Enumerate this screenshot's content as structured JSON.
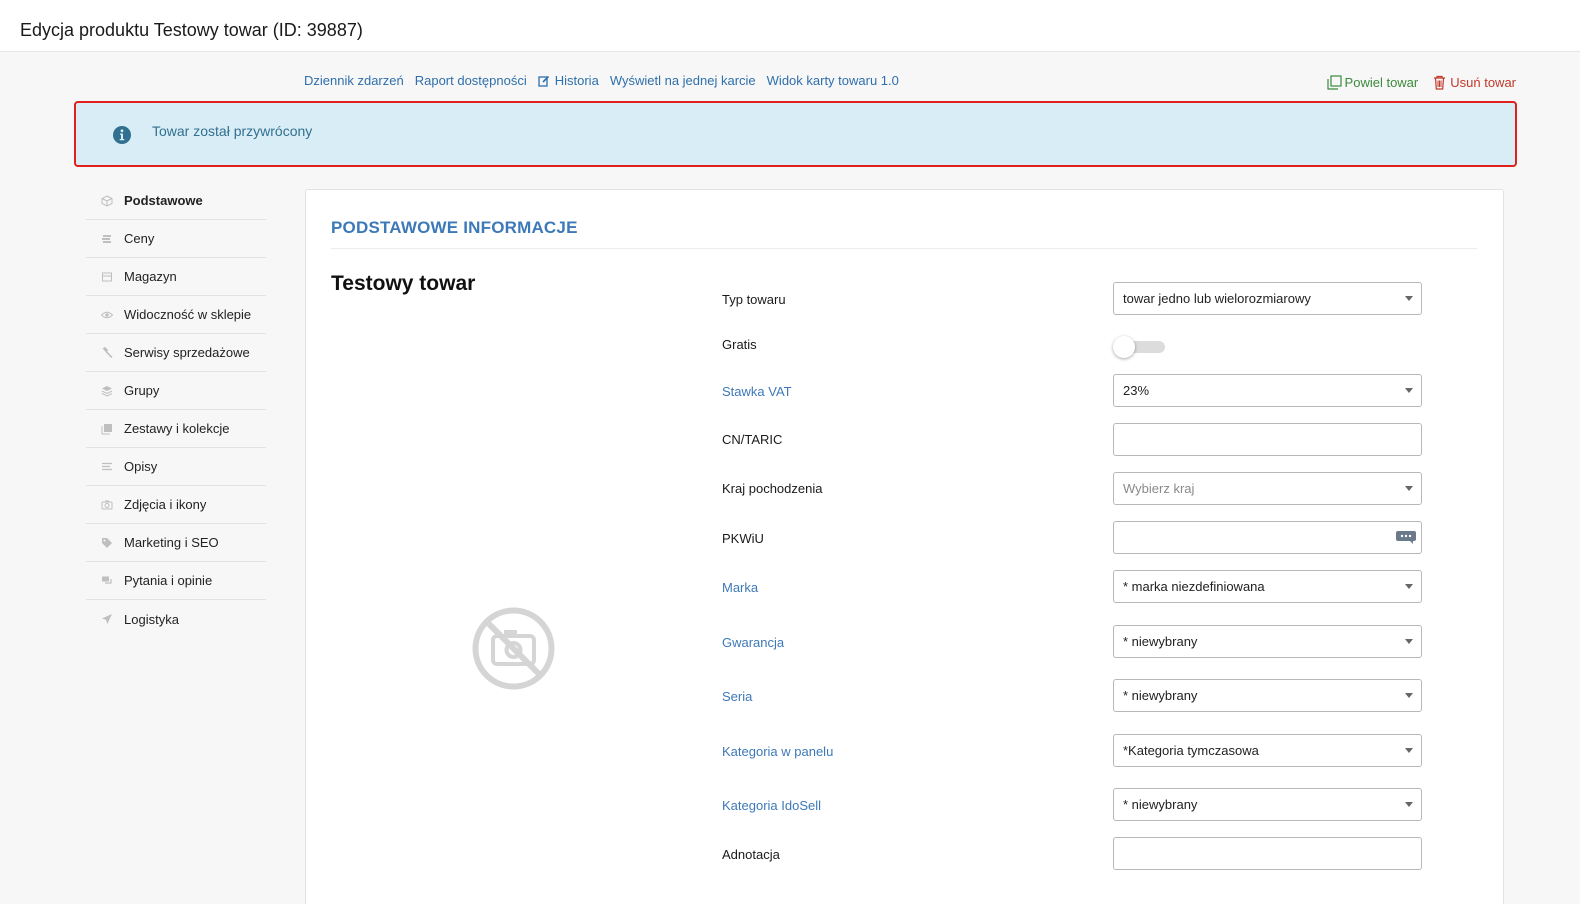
{
  "page": {
    "title": "Edycja produktu Testowy towar (ID: 39887)"
  },
  "topnav": [
    {
      "label": "Dziennik zdarzeń"
    },
    {
      "label": "Raport dostępności"
    },
    {
      "label": "Historia",
      "icon": "edit-icon"
    },
    {
      "label": "Wyświetl na jednej karcie"
    },
    {
      "label": "Widok karty towaru 1.0"
    }
  ],
  "actions": {
    "copy_label": "Powiel towar",
    "delete_label": "Usuń towar"
  },
  "alert": {
    "text": "Towar został przywrócony",
    "icon": "info-icon"
  },
  "sidebar": {
    "items": [
      {
        "label": "Podstawowe",
        "icon": "box-icon",
        "active": true
      },
      {
        "label": "Ceny",
        "icon": "coins-icon"
      },
      {
        "label": "Magazyn",
        "icon": "warehouse-icon"
      },
      {
        "label": "Widoczność w sklepie",
        "icon": "eye-icon"
      },
      {
        "label": "Serwisy sprzedażowe",
        "icon": "gavel-icon"
      },
      {
        "label": "Grupy",
        "icon": "layers-icon"
      },
      {
        "label": "Zestawy i kolekcje",
        "icon": "stack-icon"
      },
      {
        "label": "Opisy",
        "icon": "text-lines-icon"
      },
      {
        "label": "Zdjęcia i ikony",
        "icon": "camera-icon"
      },
      {
        "label": "Marketing i SEO",
        "icon": "tag-icon"
      },
      {
        "label": "Pytania i opinie",
        "icon": "comments-icon"
      },
      {
        "label": "Logistyka",
        "icon": "paper-plane-icon"
      }
    ]
  },
  "main": {
    "section_title": "PODSTAWOWE INFORMACJE",
    "product_name": "Testowy towar",
    "fields": {
      "typ_towaru": {
        "label": "Typ towaru",
        "value": "towar jedno lub wielorozmiarowy"
      },
      "gratis": {
        "label": "Gratis",
        "on": false
      },
      "stawka_vat": {
        "label": "Stawka VAT",
        "value": "23%"
      },
      "cn_taric": {
        "label": "CN/TARIC",
        "value": ""
      },
      "kraj_pochodzenia": {
        "label": "Kraj pochodzenia",
        "placeholder": "Wybierz kraj"
      },
      "pkwiu": {
        "label": "PKWiU",
        "value": ""
      },
      "marka": {
        "label": "Marka",
        "value": "* marka niezdefiniowana"
      },
      "gwarancja": {
        "label": "Gwarancja",
        "value": "* niewybrany"
      },
      "seria": {
        "label": "Seria",
        "value": "* niewybrany"
      },
      "kategoria_panel": {
        "label": "Kategoria w panelu",
        "value": "*Kategoria tymczasowa"
      },
      "kategoria_idosell": {
        "label": "Kategoria IdoSell",
        "value": "* niewybrany"
      },
      "adnotacja": {
        "label": "Adnotacja",
        "value": ""
      }
    }
  },
  "colors": {
    "link": "#3d79b8",
    "alert_bg": "#d9edf7",
    "alert_text": "#31708f",
    "alert_border": "#e0201a",
    "copy": "#3b8a3b",
    "delete": "#c0392b"
  }
}
